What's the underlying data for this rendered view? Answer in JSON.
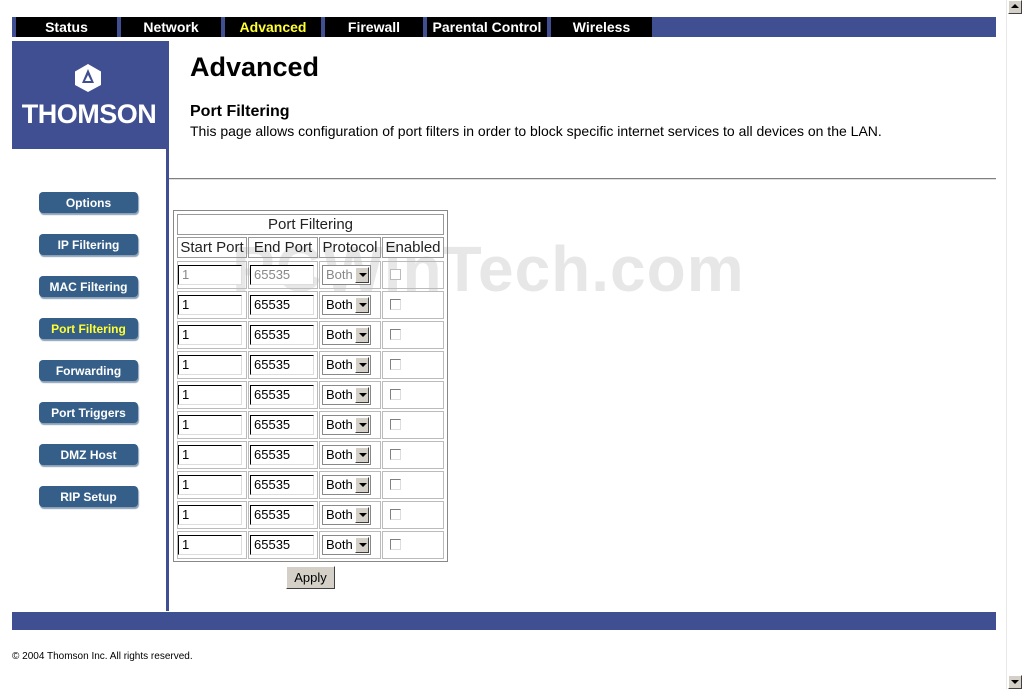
{
  "nav": {
    "tabs": [
      {
        "label": "Status",
        "active": false
      },
      {
        "label": "Network",
        "active": false
      },
      {
        "label": "Advanced",
        "active": true
      },
      {
        "label": "Firewall",
        "active": false
      },
      {
        "label": "Parental Control",
        "active": false
      },
      {
        "label": "Wireless",
        "active": false
      }
    ]
  },
  "logo": {
    "brand": "THOMSON"
  },
  "header": {
    "title": "Advanced",
    "subtitle": "Port Filtering",
    "description": "This page allows configuration of port filters in order to block specific internet services to all devices on the LAN."
  },
  "sidebar": {
    "items": [
      {
        "label": "Options",
        "active": false
      },
      {
        "label": "IP Filtering",
        "active": false
      },
      {
        "label": "MAC Filtering",
        "active": false
      },
      {
        "label": "Port Filtering",
        "active": true
      },
      {
        "label": "Forwarding",
        "active": false
      },
      {
        "label": "Port Triggers",
        "active": false
      },
      {
        "label": "DMZ Host",
        "active": false
      },
      {
        "label": "RIP Setup",
        "active": false
      }
    ]
  },
  "table": {
    "title": "Port Filtering",
    "columns": [
      "Start Port",
      "End Port",
      "Protocol",
      "Enabled"
    ],
    "rows": [
      {
        "start": "1",
        "end": "65535",
        "protocol": "Both",
        "enabled": false,
        "disabled": true
      },
      {
        "start": "1",
        "end": "65535",
        "protocol": "Both",
        "enabled": false,
        "disabled": false
      },
      {
        "start": "1",
        "end": "65535",
        "protocol": "Both",
        "enabled": false,
        "disabled": false
      },
      {
        "start": "1",
        "end": "65535",
        "protocol": "Both",
        "enabled": false,
        "disabled": false
      },
      {
        "start": "1",
        "end": "65535",
        "protocol": "Both",
        "enabled": false,
        "disabled": false
      },
      {
        "start": "1",
        "end": "65535",
        "protocol": "Both",
        "enabled": false,
        "disabled": false
      },
      {
        "start": "1",
        "end": "65535",
        "protocol": "Both",
        "enabled": false,
        "disabled": false
      },
      {
        "start": "1",
        "end": "65535",
        "protocol": "Both",
        "enabled": false,
        "disabled": false
      },
      {
        "start": "1",
        "end": "65535",
        "protocol": "Both",
        "enabled": false,
        "disabled": false
      },
      {
        "start": "1",
        "end": "65535",
        "protocol": "Both",
        "enabled": false,
        "disabled": false
      }
    ],
    "apply_label": "Apply"
  },
  "watermark": "PCWinTech.com",
  "footer": {
    "copyright": "© 2004 Thomson Inc.  All rights reserved."
  },
  "colors": {
    "brand_blue": "#3f4f92",
    "button_blue": "#355f88",
    "active_text": "#ffff33"
  }
}
